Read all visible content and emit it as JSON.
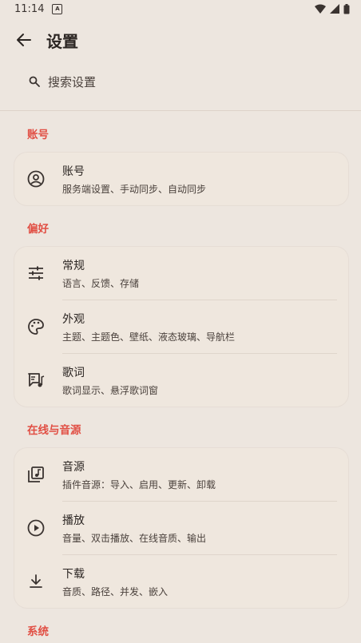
{
  "status_bar": {
    "time": "11:14"
  },
  "app_bar": {
    "title": "设置"
  },
  "search": {
    "placeholder": "搜索设置"
  },
  "sections": [
    {
      "title": "账号",
      "items": [
        {
          "icon": "account-circle-icon",
          "title": "账号",
          "subtitle": "服务端设置、手动同步、自动同步"
        }
      ]
    },
    {
      "title": "偏好",
      "items": [
        {
          "icon": "tune-icon",
          "title": "常规",
          "subtitle": "语言、反馈、存储"
        },
        {
          "icon": "palette-icon",
          "title": "外观",
          "subtitle": "主题、主题色、壁纸、液态玻璃、导航栏"
        },
        {
          "icon": "lyrics-icon",
          "title": "歌词",
          "subtitle": "歌词显示、悬浮歌词窗"
        }
      ]
    },
    {
      "title": "在线与音源",
      "items": [
        {
          "icon": "music-library-icon",
          "title": "音源",
          "subtitle": "插件音源：导入、启用、更新、卸载"
        },
        {
          "icon": "play-circle-icon",
          "title": "播放",
          "subtitle": "音量、双击播放、在线音质、输出"
        },
        {
          "icon": "download-icon",
          "title": "下载",
          "subtitle": "音质、路径、并发、嵌入"
        }
      ]
    },
    {
      "title": "系统",
      "items": []
    }
  ],
  "colors": {
    "background": "#ede6df",
    "card": "#efe7de",
    "accent": "#e14f44"
  }
}
